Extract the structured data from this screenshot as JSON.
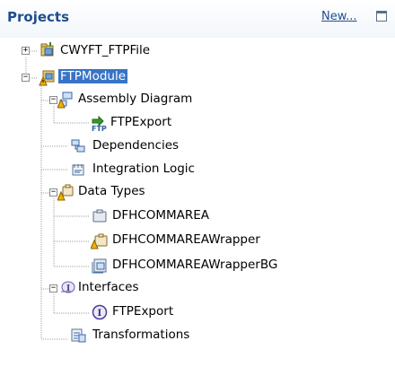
{
  "view": {
    "title": "Projects",
    "new_link": "New..."
  },
  "tree": {
    "project1": "CWYFT_FTPFile",
    "module": "FTPModule",
    "assembly": "Assembly Diagram",
    "ftp_export": "FTPExport",
    "dependencies": "Dependencies",
    "integration_logic": "Integration Logic",
    "data_types": "Data Types",
    "dt1": "DFHCOMMAREA",
    "dt2": "DFHCOMMAREAWrapper",
    "dt3": "DFHCOMMAREAWrapperBG",
    "interfaces": "Interfaces",
    "iface1": "FTPExport",
    "transformations": "Transformations"
  },
  "icons": {
    "project": "project-icon",
    "module": "module-warning-icon",
    "assembly": "assembly-diagram-icon",
    "export": "ftp-export-icon",
    "dependencies": "dependencies-icon",
    "integration": "integration-logic-icon",
    "datatypes": "data-types-icon",
    "bo": "business-object-icon",
    "iface": "interface-icon",
    "transform": "transformations-icon"
  },
  "colors": {
    "title": "#1f4e8c",
    "selection": "#3874c7",
    "warning": "#f0b400"
  }
}
